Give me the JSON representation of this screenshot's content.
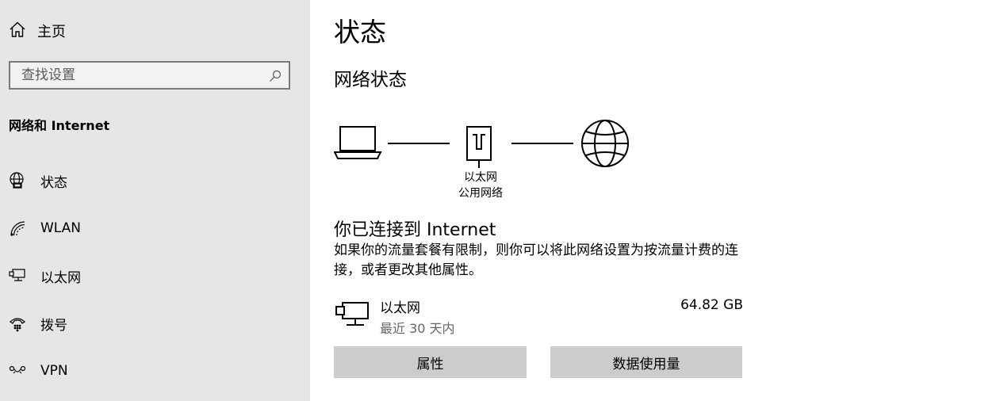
{
  "sidebar": {
    "home_label": "主页",
    "search_placeholder": "查找设置",
    "section_title": "网络和 Internet",
    "items": [
      {
        "label": "状态",
        "icon": "status-globe-icon"
      },
      {
        "label": "WLAN",
        "icon": "wifi-icon"
      },
      {
        "label": "以太网",
        "icon": "ethernet-icon"
      },
      {
        "label": "拨号",
        "icon": "dialup-icon"
      },
      {
        "label": "VPN",
        "icon": "vpn-icon"
      }
    ]
  },
  "main": {
    "title": "状态",
    "network_status_title": "网络状态",
    "network_name": "以太网",
    "network_profile": "公用网络",
    "connected_text": "你已连接到 Internet",
    "description": "如果你的流量套餐有限制，则你可以将此网络设置为按流量计费的连接，或者更改其他属性。",
    "adapter": {
      "name": "以太网",
      "period": "最近 30 天内",
      "usage": "64.82 GB"
    },
    "buttons": {
      "properties": "属性",
      "data_usage": "数据使用量"
    }
  }
}
